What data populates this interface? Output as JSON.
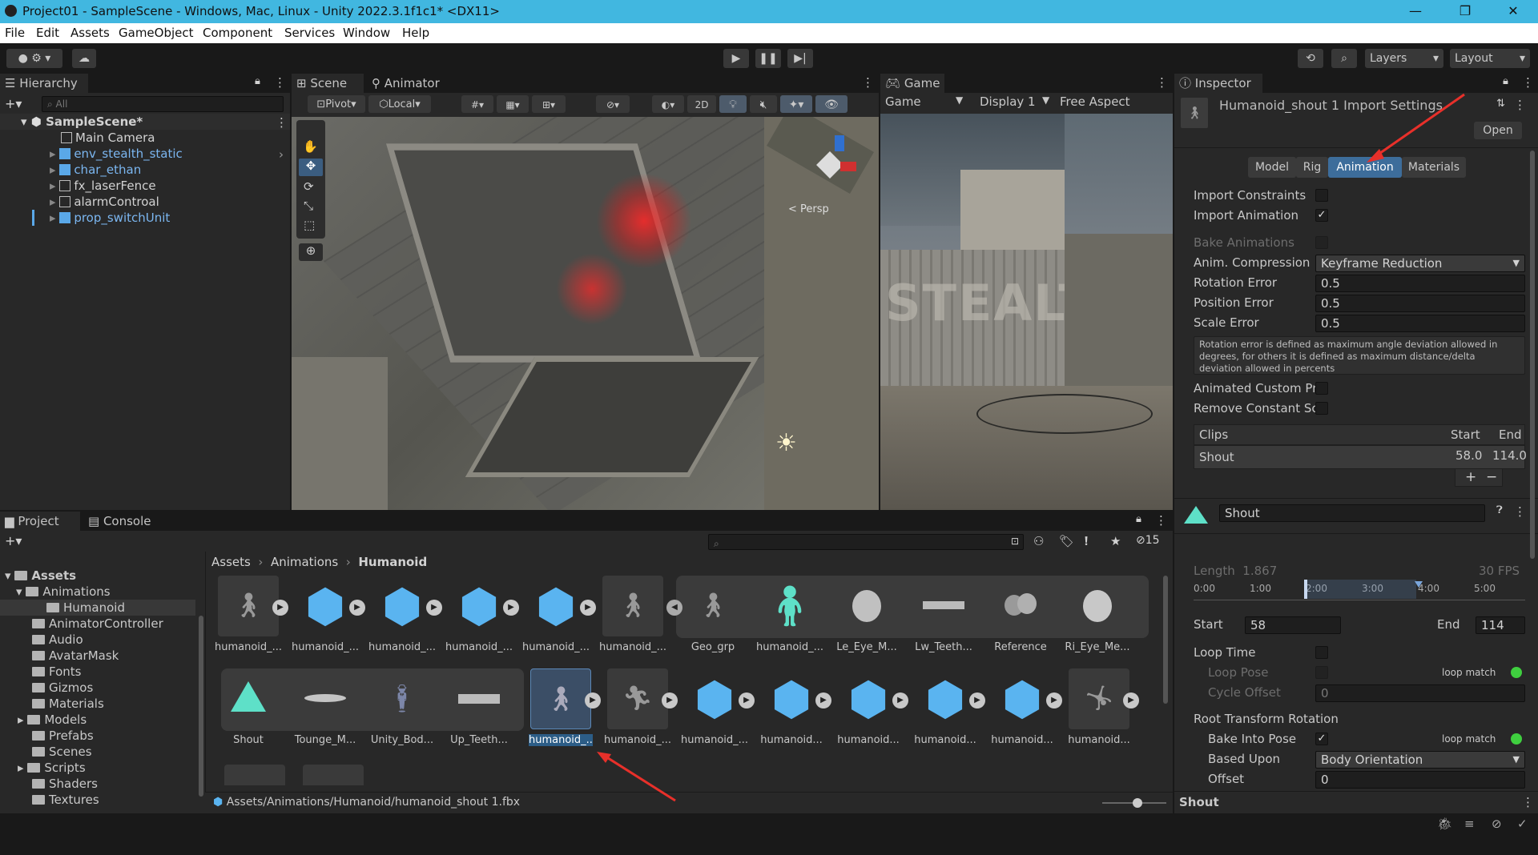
{
  "window": {
    "title": "Project01 - SampleScene - Windows, Mac, Linux - Unity 2022.3.1f1c1* <DX11>"
  },
  "menu": [
    "File",
    "Edit",
    "Assets",
    "GameObject",
    "Component",
    "Services",
    "Window",
    "Help"
  ],
  "toolbar": {
    "layers_label": "Layers",
    "layout_label": "Layout"
  },
  "hierarchy": {
    "tab": "Hierarchy",
    "search_placeholder": "All",
    "scene": "SampleScene*",
    "items": [
      {
        "label": "Main Camera",
        "prefab": false
      },
      {
        "label": "env_stealth_static",
        "prefab": true
      },
      {
        "label": "char_ethan",
        "prefab": true
      },
      {
        "label": "fx_laserFence",
        "prefab": false
      },
      {
        "label": "alarmControal",
        "prefab": false
      },
      {
        "label": "prop_switchUnit",
        "prefab": true
      }
    ]
  },
  "scene_view": {
    "tabs": [
      "Scene",
      "Animator"
    ],
    "pivot": "Pivot",
    "local": "Local",
    "mode_2d": "2D",
    "persp": "< Persp"
  },
  "game_view": {
    "tab": "Game",
    "mode": "Game",
    "display": "Display 1",
    "aspect": "Free Aspect",
    "wall_text": "STEALTH"
  },
  "inspector": {
    "tab": "Inspector",
    "title": "Humanoid_shout 1 Import Settings",
    "open_button": "Open",
    "tabs": [
      "Model",
      "Rig",
      "Animation",
      "Materials"
    ],
    "active_tab": "Animation",
    "import_constraints": "Import Constraints",
    "import_animation": "Import Animation",
    "bake_animations": "Bake Animations",
    "anim_compression_label": "Anim. Compression",
    "anim_compression_value": "Keyframe Reduction",
    "rotation_error_label": "Rotation Error",
    "rotation_error": "0.5",
    "position_error_label": "Position Error",
    "position_error": "0.5",
    "scale_error_label": "Scale Error",
    "scale_error": "0.5",
    "help_text": "Rotation error is defined as maximum angle deviation allowed in degrees, for others it is defined as maximum distance/delta deviation allowed in percents",
    "animated_custom": "Animated Custom Pr",
    "remove_constant": "Remove Constant Sc",
    "clips_header": "Clips",
    "start_header": "Start",
    "end_header": "End",
    "clip_name": "Shout",
    "clip_start": "58.0",
    "clip_end": "114.0",
    "clip_field": "Shout",
    "length_label": "Length",
    "length_value": "1.867",
    "fps": "30 FPS",
    "timeline_ticks": [
      "0:00",
      "1:00",
      "2:00",
      "3:00",
      "4:00",
      "5:00"
    ],
    "start_label": "Start",
    "start_value": "58",
    "end_label": "End",
    "end_value": "114",
    "loop_time": "Loop Time",
    "loop_pose": "Loop Pose",
    "loop_match": "loop match",
    "cycle_offset": "Cycle Offset",
    "cycle_offset_value": "0",
    "root_rotation": "Root Transform Rotation",
    "bake_into_pose": "Bake Into Pose",
    "based_upon": "Based Upon",
    "based_upon_value": "Body Orientation",
    "offset_label": "Offset",
    "offset_value": "0",
    "footer": "Shout"
  },
  "project": {
    "tabs": [
      "Project",
      "Console"
    ],
    "hidden_count": "15",
    "tree": [
      {
        "label": "Assets",
        "depth": 0,
        "bold": true
      },
      {
        "label": "Animations",
        "depth": 1
      },
      {
        "label": "Humanoid",
        "depth": 2,
        "selected": true
      },
      {
        "label": "AnimatorController",
        "depth": 1
      },
      {
        "label": "Audio",
        "depth": 1
      },
      {
        "label": "AvatarMask",
        "depth": 1
      },
      {
        "label": "Fonts",
        "depth": 1
      },
      {
        "label": "Gizmos",
        "depth": 1
      },
      {
        "label": "Materials",
        "depth": 1
      },
      {
        "label": "Models",
        "depth": 1
      },
      {
        "label": "Prefabs",
        "depth": 1
      },
      {
        "label": "Scenes",
        "depth": 1
      },
      {
        "label": "Scripts",
        "depth": 1
      },
      {
        "label": "Shaders",
        "depth": 1
      },
      {
        "label": "Textures",
        "depth": 1
      }
    ],
    "breadcrumb": [
      "Assets",
      "Animations",
      "Humanoid"
    ],
    "row1": [
      "humanoid_...",
      "humanoid_...",
      "humanoid_...",
      "humanoid_...",
      "humanoid_...",
      "humanoid_...",
      "Geo_grp",
      "humanoid_...",
      "Le_Eye_M...",
      "Lw_Teeth...",
      "Reference",
      "Ri_Eye_Me..."
    ],
    "row2": [
      "Shout",
      "Tounge_M...",
      "Unity_Bod...",
      "Up_Teeth...",
      "humanoid_...",
      "humanoid_...",
      "humanoid_...",
      "humanoid...",
      "humanoid...",
      "humanoid...",
      "humanoid...",
      "humanoid..."
    ],
    "status_path": "Assets/Animations/Humanoid/humanoid_shout 1.fbx"
  }
}
